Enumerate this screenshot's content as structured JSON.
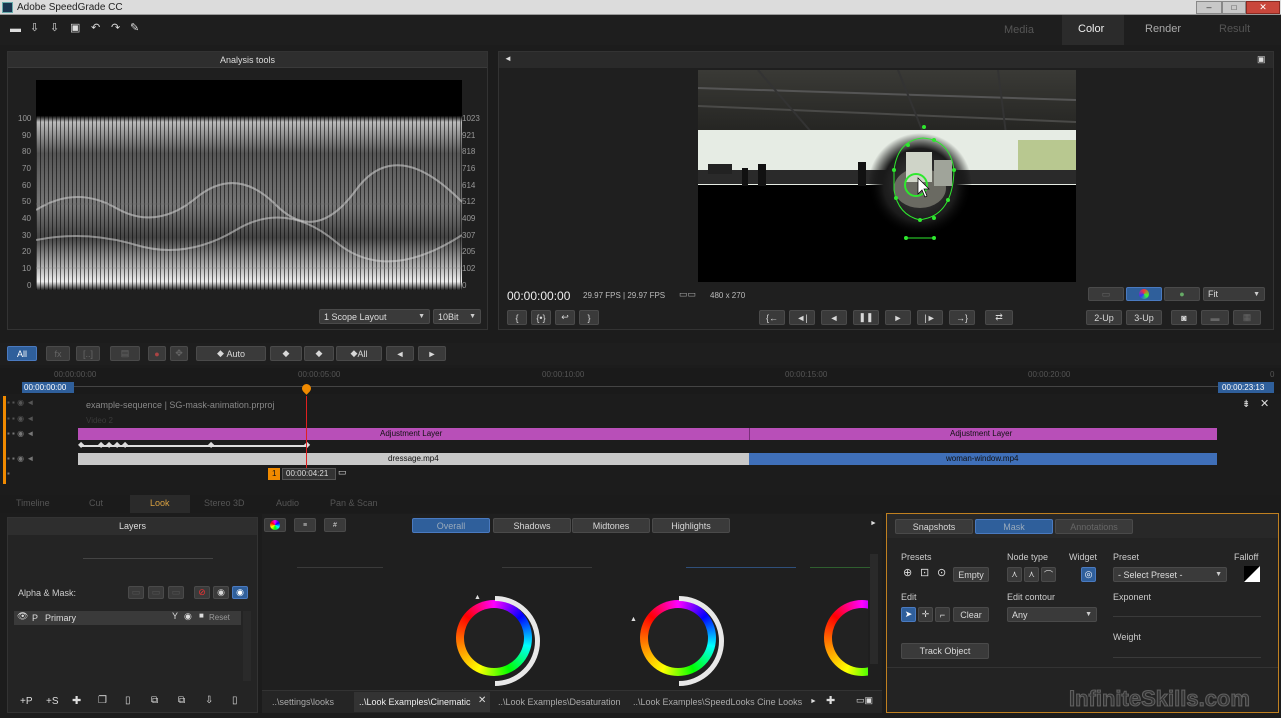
{
  "window": {
    "title": "Adobe SpeedGrade CC"
  },
  "workspace_tabs": [
    "Media",
    "Color",
    "Render",
    "Result"
  ],
  "analysis": {
    "title": "Analysis tools",
    "left_scale": [
      "100",
      "90",
      "80",
      "70",
      "60",
      "50",
      "40",
      "30",
      "20",
      "10",
      "0"
    ],
    "right_scale": [
      "1023",
      "921",
      "818",
      "716",
      "614",
      "512",
      "409",
      "307",
      "205",
      "102",
      "0"
    ],
    "layout_dropdown": "1 Scope Layout",
    "bit_dropdown": "10Bit"
  },
  "viewer": {
    "timecode": "00:00:00:00",
    "fps_info": "29.97 FPS  |  29.97 FPS",
    "resolution": "480 x 270",
    "fit_dropdown": "Fit",
    "view_2up": "2-Up",
    "view_3up": "3-Up"
  },
  "timeline_toolbar": {
    "all_label": "All",
    "auto_label": "Auto",
    "all2_label": "All"
  },
  "ruler": {
    "start": "00:00:00:00",
    "marks": [
      "00:00:00:00",
      "00:00:05:00",
      "00:00:10:00",
      "00:00:15:00",
      "00:00:20:00"
    ],
    "end": "00:00:23:13",
    "end_zero": "0"
  },
  "sequence": {
    "name": "example-sequence",
    "project": "SG-mask-animation.prproj",
    "video_label": "Video 2",
    "adj1": "Adjustment Layer",
    "adj2": "Adjustment Layer",
    "clip1": "dressage.mp4",
    "clip2": "woman-window.mp4",
    "marker_num": "1",
    "marker_tc": "00:00:04:21"
  },
  "bottom_tabs": [
    "Timeline",
    "Cut",
    "Look",
    "Stereo 3D",
    "Audio",
    "Pan & Scan"
  ],
  "layers": {
    "title": "Layers",
    "alpha_mask": "Alpha & Mask:",
    "primary_letter": "P",
    "primary_name": "Primary",
    "reset": "Reset",
    "footer": [
      "+P",
      "+S"
    ]
  },
  "look": {
    "tabs": [
      "Overall",
      "Shadows",
      "Midtones",
      "Highlights"
    ],
    "paths": [
      "..\\settings\\looks",
      "..\\Look Examples\\Cinematic",
      "..\\Look Examples\\Desaturation",
      "..\\Look Examples\\SpeedLooks Cine Looks"
    ]
  },
  "mask_panel": {
    "tabs": [
      "Snapshots",
      "Mask",
      "Annotations"
    ],
    "presets_label": "Presets",
    "empty": "Empty",
    "node_type": "Node type",
    "widget": "Widget",
    "preset_label": "Preset",
    "preset_value": "- Select Preset -",
    "falloff": "Falloff",
    "edit_label": "Edit",
    "clear": "Clear",
    "edit_contour": "Edit contour",
    "contour_value": "Any",
    "exponent": "Exponent",
    "weight": "Weight",
    "track_object": "Track Object"
  },
  "watermark": "InfiniteSkills.com",
  "colors": {
    "accent_blue": "#2f5f9b",
    "adjustment": "#b84fb8",
    "clip_blue": "#3f6fb8",
    "mask_green": "#2ee82e",
    "marker_orange": "#f08a00"
  }
}
